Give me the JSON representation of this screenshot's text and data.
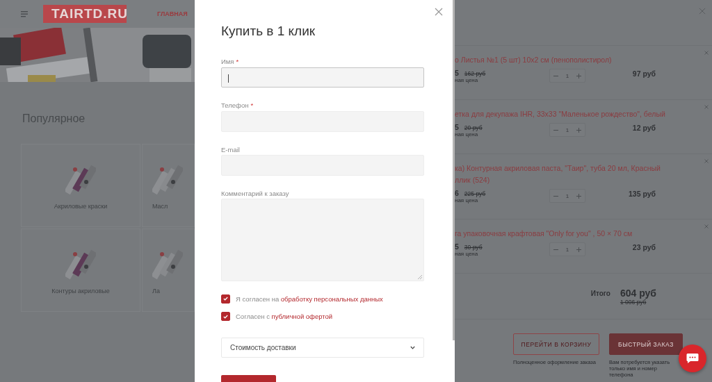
{
  "site": {
    "logo": "TAIRTD.RU",
    "nav_link": "ГЛАВНАЯ",
    "section_title": "Популярное",
    "categories": [
      {
        "label": "Акриловые краски"
      },
      {
        "label": "Масл"
      },
      {
        "label": "Контуры акриловые"
      },
      {
        "label": "Ла"
      }
    ]
  },
  "modal": {
    "title": "Купить в 1 клик",
    "fields": [
      {
        "kind": "input",
        "label": "Имя",
        "required_mark": "*",
        "focused": true
      },
      {
        "kind": "input",
        "label": "Телефон",
        "required_mark": "*",
        "focused": false
      },
      {
        "kind": "input",
        "label": "E-mail",
        "focused": false
      },
      {
        "kind": "textarea",
        "label": "Комментарий к заказу",
        "focused": false
      }
    ],
    "agreements": [
      {
        "text": "Я согласен на ",
        "link": "обработку персональных данных",
        "checked": true
      },
      {
        "text": "Согласен с ",
        "link": "публичной офертой",
        "checked": true
      }
    ],
    "delivery_select": "Стоимость доставки"
  },
  "cart": {
    "items": [
      {
        "name": "о Листья №1 (5 шт) 10х2 см (пенополистирол)",
        "price": "5",
        "old_price": "162 руб",
        "price_note": "ная цена",
        "quantity": "1",
        "total": "97 руб"
      },
      {
        "name": "етка для декупажа IHR, 33х33 \"Маленькое рождество\", белый",
        "price": "5",
        "old_price": "20 руб",
        "price_note": "ная цена",
        "quantity": "1",
        "total": "12 руб"
      },
      {
        "name": "ка) Контурная акриловая паста, \"Таир\", туба 20 мл, Красный ллик (524)",
        "price": "6",
        "old_price": "225 руб",
        "price_note": "ная цена",
        "quantity": "1",
        "total": "135 руб"
      },
      {
        "name": "га упаковочная крафтовая \"Only for you\" , 50 × 70 см",
        "price": "5",
        "old_price": "30 руб",
        "price_note": "ная цена",
        "quantity": "1",
        "total": "23 руб"
      }
    ],
    "total_label": "Итого",
    "total": "604 руб",
    "old_total": "1 006 руб",
    "actions": [
      {
        "kind": "outline",
        "label": "ПЕРЕЙТИ В КОРЗИНУ",
        "caption": "Полноценное оформление заказа"
      },
      {
        "kind": "filled",
        "label": "БЫСТРЫЙ ЗАКАЗ",
        "caption": "Вам потребуется указать только имя и номер телефона"
      }
    ]
  }
}
